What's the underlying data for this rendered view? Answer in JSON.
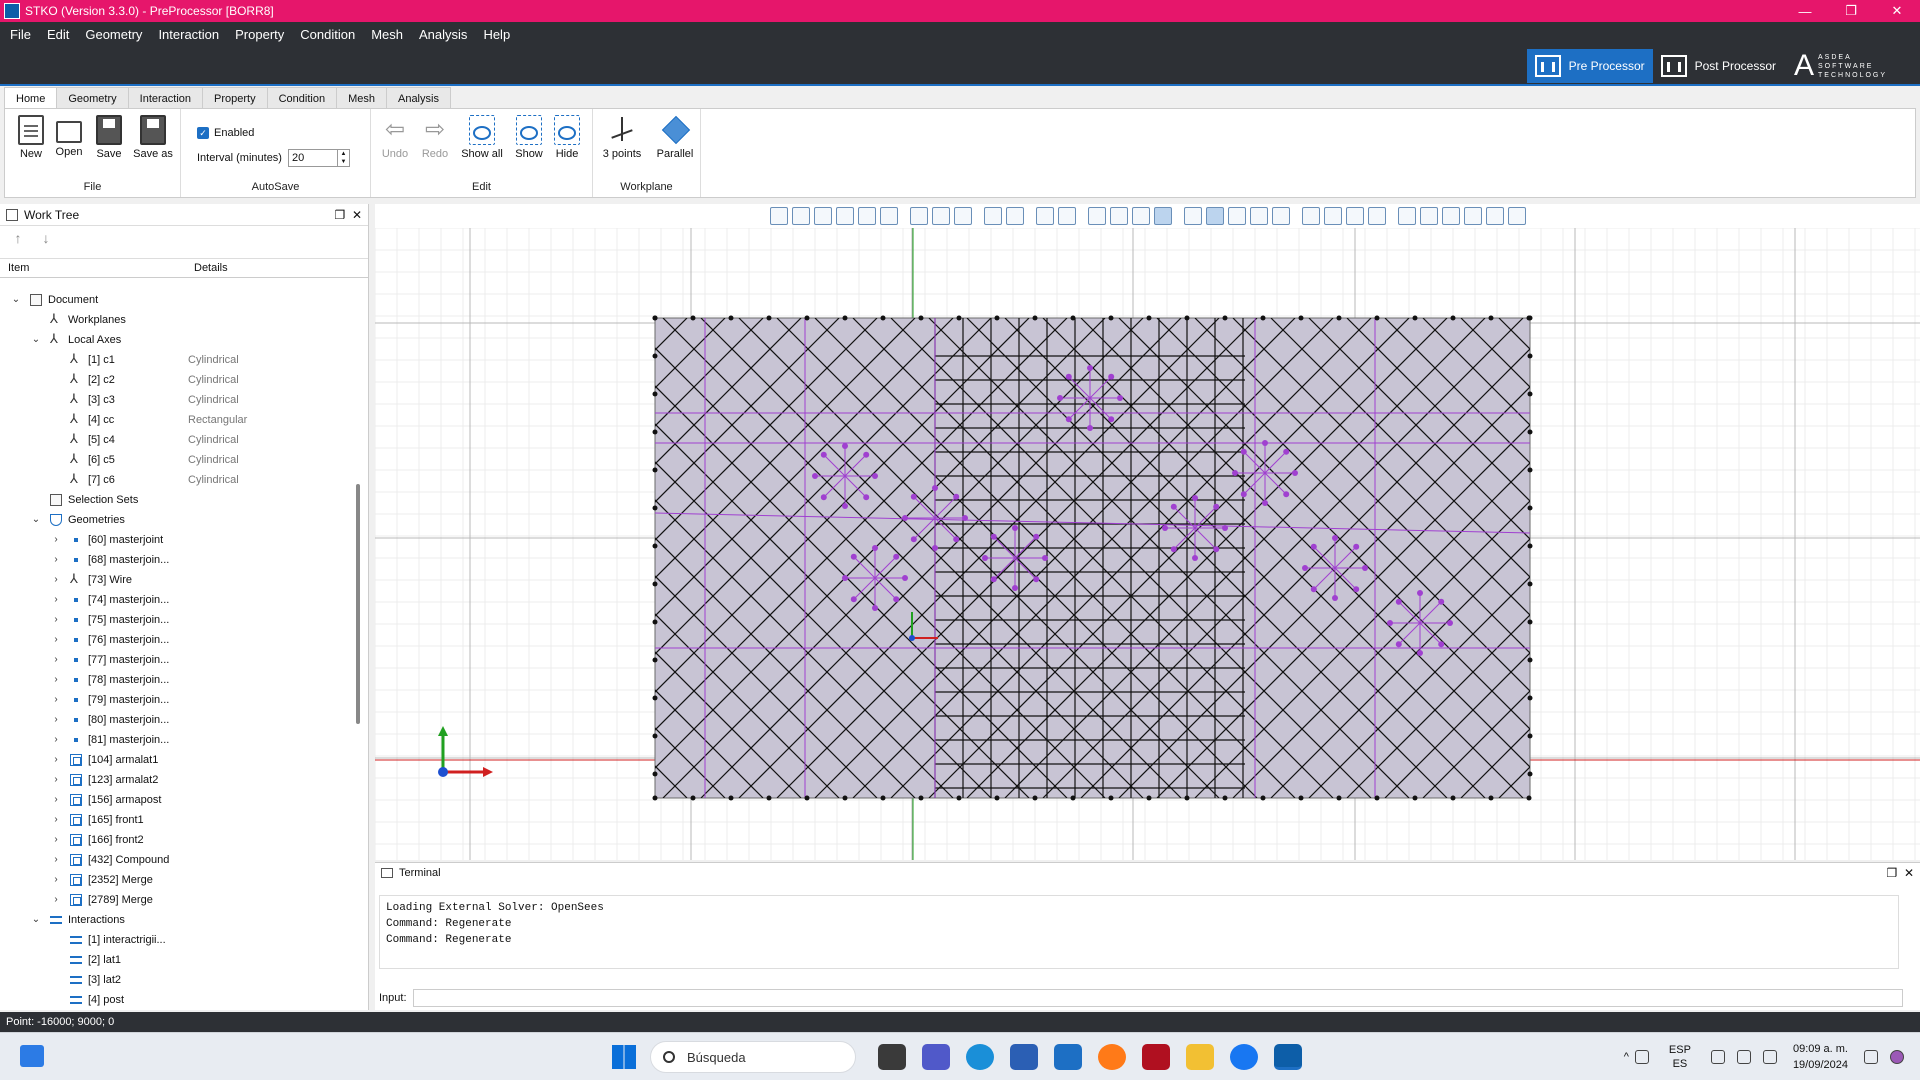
{
  "window": {
    "title": "STKO (Version 3.3.0) - PreProcessor [BORR8]",
    "controls": [
      "—",
      "❐",
      "✕"
    ]
  },
  "menu": [
    "File",
    "Edit",
    "Geometry",
    "Interaction",
    "Property",
    "Condition",
    "Mesh",
    "Analysis",
    "Help"
  ],
  "modes": {
    "pre": "Pre Processor",
    "post": "Post Processor"
  },
  "logo": {
    "mark": "A",
    "line1": "ASDEA",
    "line2": "SOFTWARE",
    "line3": "TECHNOLOGY"
  },
  "ribbon_tabs": [
    "Home",
    "Geometry",
    "Interaction",
    "Property",
    "Condition",
    "Mesh",
    "Analysis"
  ],
  "ribbon": {
    "file": {
      "label": "File",
      "new": "New",
      "open": "Open",
      "save": "Save",
      "saveas": "Save as"
    },
    "autosave": {
      "label": "AutoSave",
      "enabled": "Enabled",
      "interval_label": "Interval (minutes)",
      "interval_value": "20"
    },
    "edit": {
      "label": "Edit",
      "undo": "Undo",
      "redo": "Redo",
      "showall": "Show all",
      "show": "Show",
      "hide": "Hide"
    },
    "workplane": {
      "label": "Workplane",
      "threepoints": "3 points",
      "parallel": "Parallel"
    }
  },
  "worktree": {
    "title": "Work Tree",
    "col_item": "Item",
    "col_details": "Details",
    "rows": [
      {
        "label": "Document",
        "details": "",
        "level": 0,
        "chev": "v",
        "icon": "doc"
      },
      {
        "label": "Workplanes",
        "details": "",
        "level": 1,
        "chev": "",
        "icon": "ax"
      },
      {
        "label": "Local Axes",
        "details": "",
        "level": 1,
        "chev": "v",
        "icon": "ax"
      },
      {
        "label": "[1] c1",
        "details": "Cylindrical",
        "level": 2,
        "chev": "",
        "icon": "ax"
      },
      {
        "label": "[2] c2",
        "details": "Cylindrical",
        "level": 2,
        "chev": "",
        "icon": "ax"
      },
      {
        "label": "[3] c3",
        "details": "Cylindrical",
        "level": 2,
        "chev": "",
        "icon": "ax"
      },
      {
        "label": "[4] cc",
        "details": "Rectangular",
        "level": 2,
        "chev": "",
        "icon": "ax"
      },
      {
        "label": "[5] c4",
        "details": "Cylindrical",
        "level": 2,
        "chev": "",
        "icon": "ax"
      },
      {
        "label": "[6] c5",
        "details": "Cylindrical",
        "level": 2,
        "chev": "",
        "icon": "ax"
      },
      {
        "label": "[7] c6",
        "details": "Cylindrical",
        "level": 2,
        "chev": "",
        "icon": "ax"
      },
      {
        "label": "Selection Sets",
        "details": "",
        "level": 1,
        "chev": "",
        "icon": "doc"
      },
      {
        "label": "Geometries",
        "details": "",
        "level": 1,
        "chev": "v",
        "icon": "funnel"
      },
      {
        "label": "[60] masterjoint",
        "details": "",
        "level": 2,
        "chev": ">",
        "icon": "dot"
      },
      {
        "label": "[68] masterjoin...",
        "details": "",
        "level": 2,
        "chev": ">",
        "icon": "dot"
      },
      {
        "label": "[73] Wire",
        "details": "",
        "level": 2,
        "chev": ">",
        "icon": "ax"
      },
      {
        "label": "[74] masterjoin...",
        "details": "",
        "level": 2,
        "chev": ">",
        "icon": "dot"
      },
      {
        "label": "[75] masterjoin...",
        "details": "",
        "level": 2,
        "chev": ">",
        "icon": "dot"
      },
      {
        "label": "[76] masterjoin...",
        "details": "",
        "level": 2,
        "chev": ">",
        "icon": "dot"
      },
      {
        "label": "[77] masterjoin...",
        "details": "",
        "level": 2,
        "chev": ">",
        "icon": "dot"
      },
      {
        "label": "[78] masterjoin...",
        "details": "",
        "level": 2,
        "chev": ">",
        "icon": "dot"
      },
      {
        "label": "[79] masterjoin...",
        "details": "",
        "level": 2,
        "chev": ">",
        "icon": "dot"
      },
      {
        "label": "[80] masterjoin...",
        "details": "",
        "level": 2,
        "chev": ">",
        "icon": "dot"
      },
      {
        "label": "[81] masterjoin...",
        "details": "",
        "level": 2,
        "chev": ">",
        "icon": "dot"
      },
      {
        "label": "[104] armalat1",
        "details": "",
        "level": 2,
        "chev": ">",
        "icon": "box3"
      },
      {
        "label": "[123] armalat2",
        "details": "",
        "level": 2,
        "chev": ">",
        "icon": "box3"
      },
      {
        "label": "[156] armapost",
        "details": "",
        "level": 2,
        "chev": ">",
        "icon": "box3"
      },
      {
        "label": "[165] front1",
        "details": "",
        "level": 2,
        "chev": ">",
        "icon": "box3"
      },
      {
        "label": "[166] front2",
        "details": "",
        "level": 2,
        "chev": ">",
        "icon": "box3"
      },
      {
        "label": "[432] Compound",
        "details": "",
        "level": 2,
        "chev": ">",
        "icon": "box3"
      },
      {
        "label": "[2352] Merge",
        "details": "",
        "level": 2,
        "chev": ">",
        "icon": "box3"
      },
      {
        "label": "[2789] Merge",
        "details": "",
        "level": 2,
        "chev": ">",
        "icon": "box3"
      },
      {
        "label": "Interactions",
        "details": "",
        "level": 1,
        "chev": "v",
        "icon": "grid"
      },
      {
        "label": "[1] interactrigii...",
        "details": "",
        "level": 2,
        "chev": "",
        "icon": "grid"
      },
      {
        "label": "[2] lat1",
        "details": "",
        "level": 2,
        "chev": "",
        "icon": "grid"
      },
      {
        "label": "[3] lat2",
        "details": "",
        "level": 2,
        "chev": "",
        "icon": "grid"
      },
      {
        "label": "[4] post",
        "details": "",
        "level": 2,
        "chev": "",
        "icon": "grid"
      }
    ]
  },
  "terminal": {
    "title": "Terminal",
    "lines": [
      "Loading External Solver: OpenSees",
      "Command: Regenerate",
      "Command: Regenerate"
    ],
    "input_label": "Input:"
  },
  "status": "Point: -16000; 9000; 0",
  "taskbar": {
    "search": "Búsqueda",
    "lang1": "ESP",
    "lang2": "ES",
    "time": "09:09 a. m.",
    "date": "19/09/2024"
  },
  "colors": {
    "titlebar": "#e6166b",
    "menubar": "#2d3035",
    "accent": "#1d6fc4",
    "mesh_fill": "#c8c4d4",
    "mesh_line": "#111111",
    "purple": "#a040d0",
    "axis_x": "#d02020",
    "axis_y": "#20a020"
  }
}
